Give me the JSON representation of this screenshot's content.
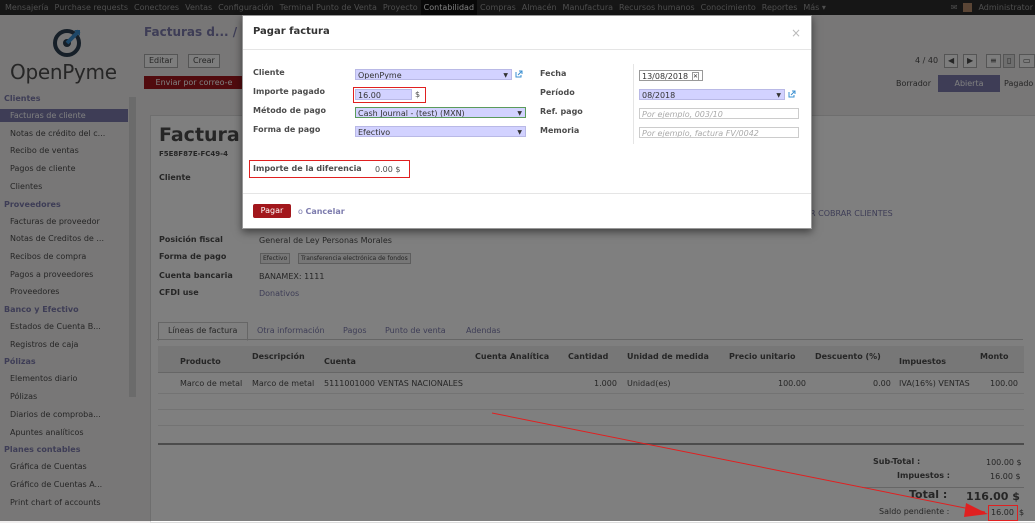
{
  "topbar": {
    "menu": [
      "Mensajería",
      "Purchase requests",
      "Conectores",
      "Ventas",
      "Configuración",
      "Terminal Punto de Venta",
      "Proyecto",
      "Contabilidad",
      "Compras",
      "Almacén",
      "Manufactura",
      "Recursos humanos",
      "Conocimiento",
      "Reportes",
      "Más ▾"
    ],
    "active_index": 7,
    "user": "Administrator"
  },
  "logo": {
    "text": "OpenPyme"
  },
  "sidebar": {
    "sections": [
      {
        "title": "Clientes",
        "items": [
          "Facturas de cliente",
          "Notas de crédito del c...",
          "Recibo de ventas",
          "Pagos de cliente",
          "Clientes"
        ]
      },
      {
        "title": "Proveedores",
        "items": [
          "Facturas de proveedor",
          "Notas de Creditos de ...",
          "Recibos de compra",
          "Pagos a proveedores",
          "Proveedores"
        ]
      },
      {
        "title": "Banco y Efectivo",
        "items": [
          "Estados de Cuenta B...",
          "Registros de caja"
        ]
      },
      {
        "title": "Pólizas",
        "items": [
          "Elementos diario",
          "Pólizas",
          "Diarios de comproba...",
          "Apuntes analíticos"
        ]
      },
      {
        "title": "Planes contables",
        "items": [
          "Gráfica de Cuentas",
          "Gráfico de Cuentas A...",
          "Print chart of accounts"
        ]
      }
    ],
    "selected": "Facturas de cliente"
  },
  "control_panel": {
    "breadcrumb": "Facturas d... / 8",
    "edit_label": "Editar",
    "create_label": "Crear",
    "send_label": "Enviar por correo-e",
    "pager": "4 / 40",
    "states": [
      "Borrador",
      "Abierta",
      "Pagado"
    ]
  },
  "invoice": {
    "title": "Factura 8",
    "uuid": "F5E8F87E-FC49-4",
    "client_label": "Cliente",
    "receivable_text": "R COBRAR CLIENTES",
    "fiscal_label": "Posición fiscal",
    "fiscal_value": "General de Ley Personas Morales",
    "payment_form_label": "Forma de pago",
    "payment_tags": [
      "Efectivo",
      "Transferencia electrónica de fondos"
    ],
    "bank_label": "Cuenta bancaria",
    "bank_value": "BANAMEX: 1111",
    "cfdi_label": "CFDI use",
    "cfdi_value": "Donativos",
    "tabs": [
      "Líneas de factura",
      "Otra información",
      "Pagos",
      "Punto de venta",
      "Adendas"
    ],
    "columns": [
      "Producto",
      "Descripción",
      "Cuenta",
      "Cuenta Analítica",
      "Cantidad",
      "Unidad de medida",
      "Precio unitario",
      "Descuento (%)",
      "Impuestos",
      "Monto"
    ],
    "row": [
      "Marco de metal",
      "Marco de metal",
      "5111001000 VENTAS NACIONALES",
      "",
      "1.000",
      "Unidad(es)",
      "100.00",
      "0.00",
      "IVA(16%) VENTAS",
      "100.00"
    ],
    "subtotal_label": "Sub-Total :",
    "subtotal": "100.00 $",
    "tax_label": "Impuestos :",
    "tax": "16.00 $",
    "total_label": "Total :",
    "total": "116.00 $",
    "balance_label": "Saldo pendiente :",
    "balance": "16.00",
    "balance_currency": "$"
  },
  "modal": {
    "title": "Pagar factura",
    "close": "×",
    "cliente_label": "Cliente",
    "cliente_value": "OpenPyme",
    "importe_label": "Importe pagado",
    "importe_value": "16.00",
    "currency": "$",
    "metodo_label": "Método de pago",
    "metodo_value": "Cash Journal - (test) (MXN)",
    "forma_label": "Forma de pago",
    "forma_value": "Efectivo",
    "fecha_label": "Fecha",
    "fecha_value": "13/08/2018",
    "periodo_label": "Período",
    "periodo_value": "08/2018",
    "ref_label": "Ref. pago",
    "ref_placeholder": "Por ejemplo, 003/10",
    "memoria_label": "Memoria",
    "memoria_placeholder": "Por ejemplo, factura FV/0042",
    "diff_label": "Importe de la diferencia",
    "diff_value": "0.00 $",
    "pay_label": "Pagar",
    "or_label": "o",
    "cancel_label": "Cancelar"
  },
  "colors": {
    "accent": "#7c7bad",
    "danger": "#a2171c",
    "annotation": "#e02020"
  }
}
